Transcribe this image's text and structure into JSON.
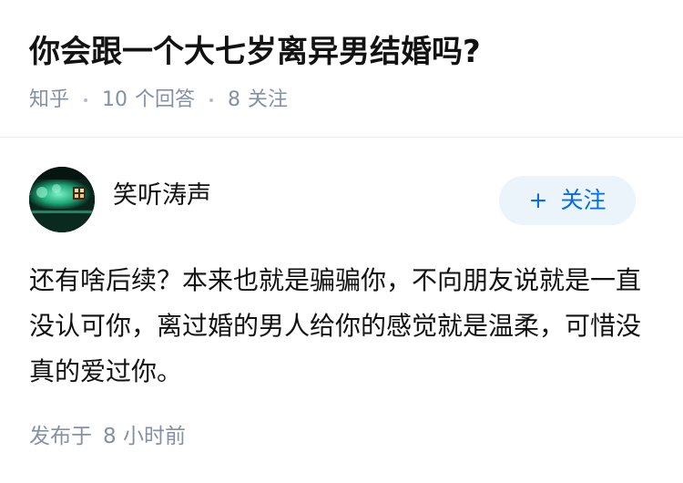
{
  "question": {
    "title": "你会跟一个大七岁离异男结婚吗?",
    "source": "知乎",
    "answer_count": "10",
    "answer_label": "个回答",
    "follower_count": "8",
    "follower_label": "关注"
  },
  "answer": {
    "author": {
      "name": "笑听涛声",
      "avatar_icon": "user-avatar-image"
    },
    "follow_button": {
      "icon": "plus-icon",
      "plus_symbol": "+",
      "label": "关注"
    },
    "content": "还有啥后续？本来也就是骗骗你，不向朋友说就是一直没认可你，离过婚的男人给你的感觉就是温柔，可惜没真的爱过你。",
    "published_label": "发布于",
    "published_time": "8 小时前"
  },
  "colors": {
    "accent": "#056de8",
    "follow_bg": "#ebf3fb",
    "meta_text": "#8590a6",
    "main_text": "#121212"
  }
}
